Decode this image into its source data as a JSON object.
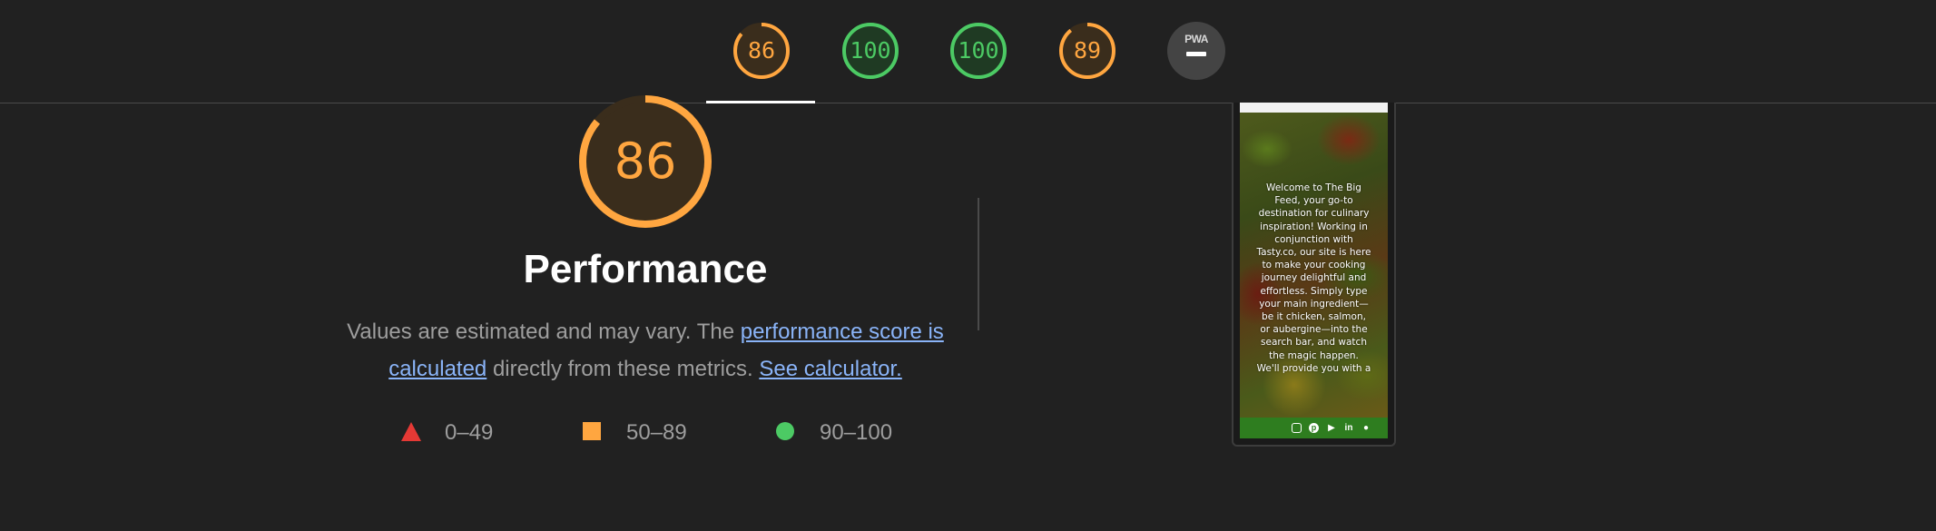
{
  "tabs": [
    {
      "score": "86",
      "color": "#ffa640",
      "bg": "#3a2d1c",
      "fraction": 0.86
    },
    {
      "score": "100",
      "color": "#4cca64",
      "bg": "#1f3a23",
      "fraction": 1.0
    },
    {
      "score": "100",
      "color": "#4cca64",
      "bg": "#1f3a23",
      "fraction": 1.0
    },
    {
      "score": "89",
      "color": "#ffa640",
      "bg": "#3a2d1c",
      "fraction": 0.89
    }
  ],
  "pwa": {
    "label": "PWA"
  },
  "category": {
    "score": "86",
    "fraction": 0.86,
    "title": "Performance",
    "desc_prefix": "Values are estimated and may vary. The ",
    "link_score": "performance score is calculated",
    "desc_middle": " directly from these metrics. ",
    "link_calc": "See calculator."
  },
  "legend": [
    {
      "range": "0–49",
      "shape": "triangle",
      "color": "#e53935"
    },
    {
      "range": "50–89",
      "shape": "square",
      "color": "#ffa640"
    },
    {
      "range": "90–100",
      "shape": "circle",
      "color": "#4cca64"
    }
  ],
  "screenshot": {
    "hero_text": "Welcome to The Big Feed, your go-to destination for culinary inspiration! Working in conjunction with Tasty.co, our site is here to make your cooking journey delightful and effortless. Simply type your main ingredient—be it chicken, salmon, or aubergine—into the search bar, and watch the magic happen. We'll provide you with a",
    "footer_color": "#2e7d1f",
    "social_icons": [
      "instagram-icon",
      "pinterest-icon",
      "youtube-icon",
      "linkedin-icon",
      "github-icon"
    ]
  }
}
